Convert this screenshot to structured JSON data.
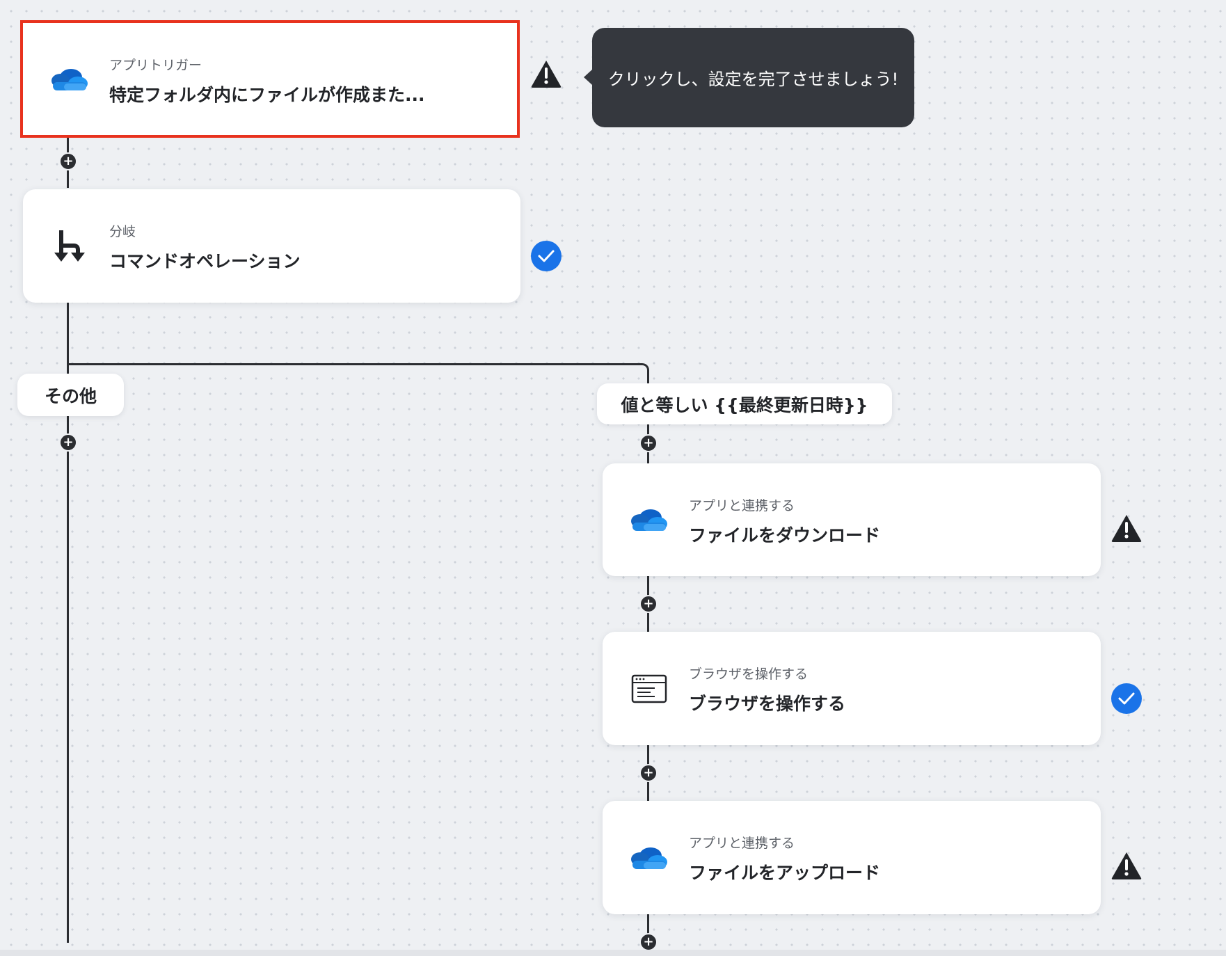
{
  "colors": {
    "canvas": "#eef0f3",
    "connector": "#2b2d31",
    "selected_border": "#e8321e",
    "check_blue": "#1a73e8",
    "warning_dark": "#222428",
    "tooltip_bg": "#35383e",
    "onedrive_blue": "#1e88e5"
  },
  "tooltip": {
    "text": "クリックし、設定を完了させましょう!"
  },
  "branches": {
    "other_label": "その他",
    "equals_label": "値と等しい {{最終更新日時}}"
  },
  "steps": [
    {
      "subtitle": "アプリトリガー",
      "title": "特定フォルダ内にファイルが作成また...",
      "icon": "onedrive-icon",
      "status": "warning",
      "selected": true
    },
    {
      "subtitle": "分岐",
      "title": "コマンドオペレーション",
      "icon": "branch-icon",
      "status": "complete",
      "selected": false
    },
    {
      "subtitle": "アプリと連携する",
      "title": "ファイルをダウンロード",
      "icon": "onedrive-icon",
      "status": "warning",
      "selected": false
    },
    {
      "subtitle": "ブラウザを操作する",
      "title": "ブラウザを操作する",
      "icon": "browser-window-icon",
      "status": "complete",
      "selected": false
    },
    {
      "subtitle": "アプリと連携する",
      "title": "ファイルをアップロード",
      "icon": "onedrive-icon",
      "status": "warning",
      "selected": false
    }
  ]
}
